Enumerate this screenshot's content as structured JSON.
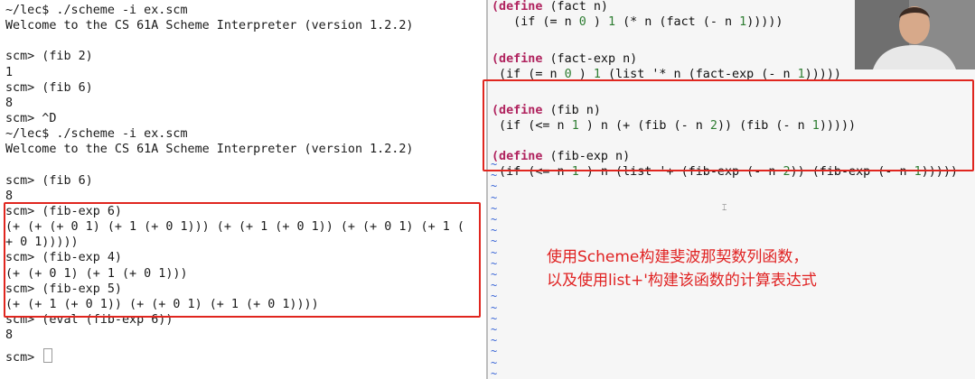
{
  "terminal": {
    "lines": [
      "~/lec$ ./scheme -i ex.scm",
      "Welcome to the CS 61A Scheme Interpreter (version 1.2.2)",
      "",
      "scm> (fib 2)",
      "1",
      "scm> (fib 6)",
      "8",
      "scm> ^D",
      "~/lec$ ./scheme -i ex.scm",
      "Welcome to the CS 61A Scheme Interpreter (version 1.2.2)",
      "",
      "scm> (fib 6)",
      "8",
      "scm> (fib-exp 6)",
      "(+ (+ (+ 0 1) (+ 1 (+ 0 1))) (+ (+ 1 (+ 0 1)) (+ (+ 0 1) (+ 1 (",
      "+ 0 1)))))",
      "scm> (fib-exp 4)",
      "(+ (+ 0 1) (+ 1 (+ 0 1)))",
      "scm> (fib-exp 5)",
      "(+ (+ 1 (+ 0 1)) (+ (+ 0 1) (+ 1 (+ 0 1))))",
      "scm> (eval (fib-exp 6))",
      "8"
    ],
    "prompt": "scm> "
  },
  "editor": {
    "code": [
      [
        [
          "kw",
          "(define"
        ],
        [
          "",
          "  (fact n)"
        ]
      ],
      [
        [
          "",
          "    (if (= n "
        ],
        [
          "num",
          "0"
        ],
        [
          "",
          " ) "
        ],
        [
          "num",
          "1"
        ],
        [
          "",
          " (* n (fact (- n "
        ],
        [
          "num",
          "1"
        ],
        [
          "",
          "))))) "
        ]
      ],
      [],
      [
        [
          "kw",
          "(define"
        ],
        [
          "",
          " (fact-exp n)"
        ]
      ],
      [
        [
          "",
          "  (if (= n "
        ],
        [
          "num",
          "0"
        ],
        [
          "",
          " ) "
        ],
        [
          "num",
          "1"
        ],
        [
          "",
          " (list '* n (fact-exp (- n "
        ],
        [
          "num",
          "1"
        ],
        [
          "",
          ")))))"
        ]
      ],
      [],
      [
        [
          "kw",
          "(define"
        ],
        [
          "",
          " (fib n)"
        ]
      ],
      [
        [
          "",
          "  (if (<= n "
        ],
        [
          "num",
          "1"
        ],
        [
          "",
          " ) n (+ (fib (- n "
        ],
        [
          "num",
          "2"
        ],
        [
          "",
          ")) (fib (- n "
        ],
        [
          "num",
          "1"
        ],
        [
          "",
          "))))) "
        ]
      ],
      [],
      [
        [
          "kw",
          "(define"
        ],
        [
          "",
          " (fib-exp n)"
        ]
      ],
      [
        [
          "",
          "  (if (<= n "
        ],
        [
          "num",
          "1"
        ],
        [
          "",
          " ) n (list '+ (fib-exp (- n "
        ],
        [
          "num",
          "2"
        ],
        [
          "",
          ")) (fib-exp (- n "
        ],
        [
          "num",
          "1"
        ],
        [
          "",
          "))))) "
        ]
      ]
    ],
    "tilde": "~",
    "tilde_count": 20
  },
  "annotation": {
    "line1": "使用Scheme构建斐波那契数列函数，",
    "line2": "以及使用list+'构建该函数的计算表达式",
    "color": "#e02222"
  },
  "colors": {
    "highlight": "#e0261f",
    "keyword": "#b0235e",
    "number": "#2e7d32",
    "tilde": "#3a66d6"
  }
}
